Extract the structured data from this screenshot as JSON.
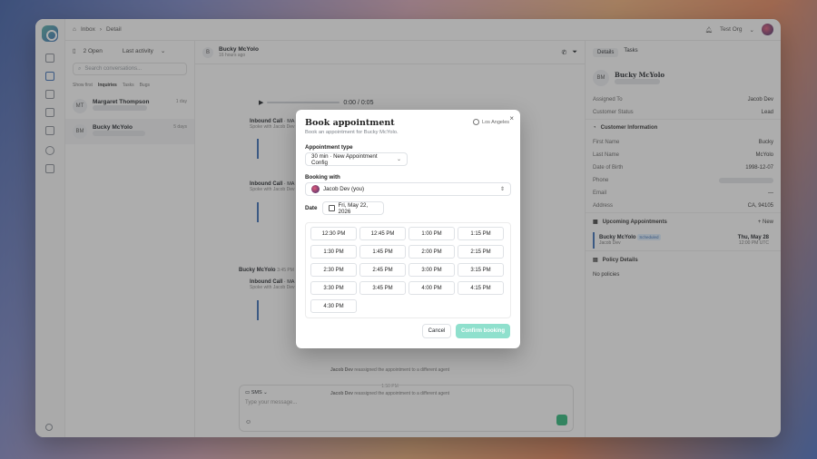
{
  "topbar": {
    "breadcrumb": [
      "Inbox",
      "Detail"
    ],
    "org": "Test Org"
  },
  "convos": {
    "open_count": "2 Open",
    "sort": "Last activity",
    "search_placeholder": "Search conversations...",
    "filters": [
      "Show first",
      "Inquiries",
      "Tasks",
      "Bugs"
    ],
    "items": [
      {
        "initials": "MT",
        "name": "Margaret Thompson",
        "time": "1 day"
      },
      {
        "initials": "BM",
        "name": "Bucky McYolo",
        "time": "5 days"
      }
    ]
  },
  "thread": {
    "name": "Bucky McYolo",
    "sub": "16 hours ago",
    "player_time": "0:00 / 0:05",
    "calls": [
      {
        "title": "Inbound Call",
        "meta": "· MA Inbound Receptionist",
        "sub": "Spoke with Jacob Dev"
      },
      {
        "title": "Inbound Call",
        "meta": "· MA Inbound",
        "sub": "Spoke with Jacob Dev"
      },
      {
        "title": "Inbound Call",
        "meta": "· MA Inbound",
        "sub": "Spoke with Jacob Dev"
      }
    ],
    "msg_author": "Bucky McYolo",
    "msg_time": "3:45 PM",
    "events": [
      {
        "who": "Jacob Dev",
        "text": "reassigned the appointment to a different agent"
      },
      {
        "who": "Jacob Dev",
        "text": "reassigned the appointment to a different agent"
      }
    ],
    "event_time": "1:50 PM",
    "composer": {
      "channel": "SMS",
      "placeholder": "Type your message..."
    }
  },
  "rpanel": {
    "tabs": [
      "Details",
      "Tasks"
    ],
    "contact_initials": "BM",
    "contact_name": "Bucky McYolo",
    "assigned_label": "Assigned To",
    "assigned_value": "Jacob Dev",
    "status_label": "Customer Status",
    "status_value": "Lead",
    "info_title": "Customer Information",
    "fields": [
      {
        "k": "First Name",
        "v": "Bucky"
      },
      {
        "k": "Last Name",
        "v": "McYolo"
      },
      {
        "k": "Date of Birth",
        "v": "1998-12-07"
      },
      {
        "k": "Phone",
        "v": ""
      },
      {
        "k": "Email",
        "v": "—"
      },
      {
        "k": "Address",
        "v": "CA, 94105"
      }
    ],
    "upcoming_title": "Upcoming Appointments",
    "new_label": "New",
    "appt": {
      "name": "Bucky McYolo",
      "badge": "Scheduled",
      "agent": "Jacob Dev",
      "date": "Thu, May 28",
      "time": "12:00 PM UTC"
    },
    "policy_title": "Policy Details",
    "policy_empty": "No policies"
  },
  "modal": {
    "title": "Book appointment",
    "subtitle": "Book an appointment for Bucky McYolo.",
    "timezone": "Los Angeles",
    "type_label": "Appointment type",
    "type_value": "30 min · New Appointment Config",
    "booking_label": "Booking with",
    "booking_value": "Jacob Dev (you)",
    "date_label": "Date",
    "date_value": "Fri, May 22, 2026",
    "slots": [
      "12:30 PM",
      "12:45 PM",
      "1:00 PM",
      "1:15 PM",
      "1:30 PM",
      "1:45 PM",
      "2:00 PM",
      "2:15 PM",
      "2:30 PM",
      "2:45 PM",
      "3:00 PM",
      "3:15 PM",
      "3:30 PM",
      "3:45 PM",
      "4:00 PM",
      "4:15 PM",
      "4:30 PM"
    ],
    "cancel": "Cancel",
    "confirm": "Confirm booking"
  }
}
